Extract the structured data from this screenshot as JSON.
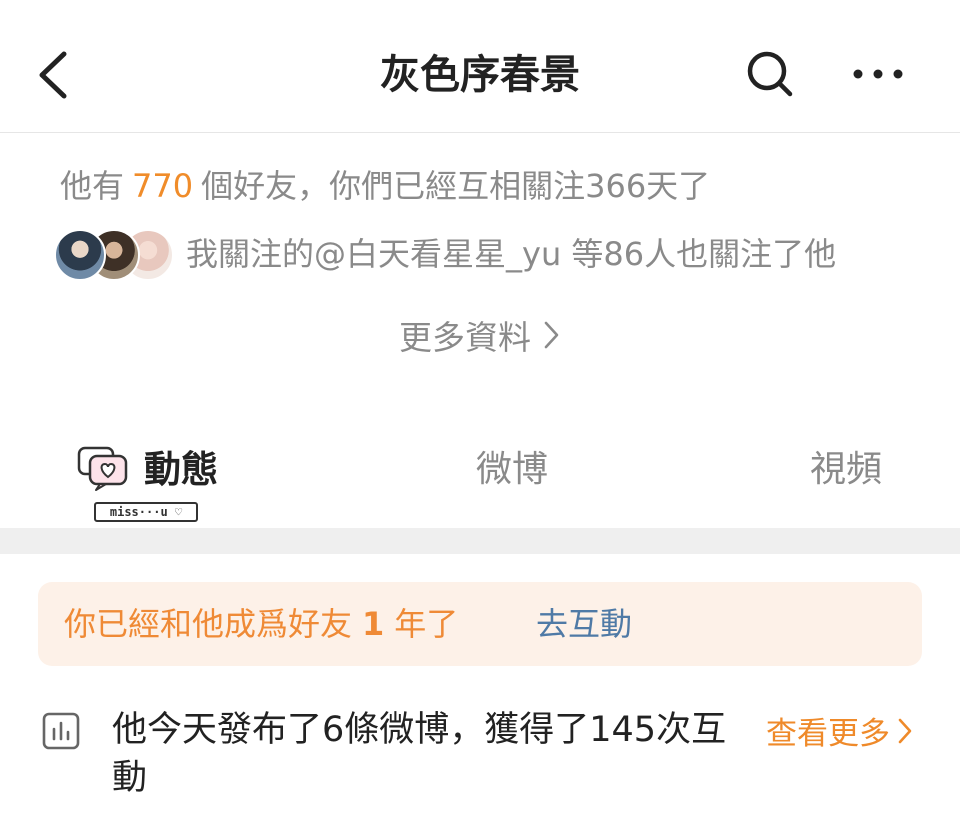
{
  "header": {
    "title": "灰色序春景",
    "back_icon": "back-arrow-icon",
    "search_icon": "search-icon",
    "more_icon": "more-dots-icon"
  },
  "friends": {
    "prefix": "他有",
    "count": "770",
    "suffix": "個好友，你們已經互相關注366天了"
  },
  "mutual": {
    "text": "我關注的@白天看星星_yu  等86人也關注了他"
  },
  "more_info": {
    "label": "更多資料"
  },
  "tabs": [
    {
      "label": "動態",
      "active": true
    },
    {
      "label": "微博",
      "active": false
    },
    {
      "label": "視頻",
      "active": false
    }
  ],
  "sticker_badge": "miss···u ♡",
  "banner": {
    "text_before": "你已經和他成爲好友",
    "years": "1",
    "text_after": "年了",
    "link": "去互動"
  },
  "stats": {
    "text": "他今天發布了6條微博，獲得了145次互動",
    "view_more": "查看更多"
  },
  "colors": {
    "accent_orange": "#ef8a2a",
    "link_blue": "#4f7aa6",
    "banner_bg": "#fdf1e8",
    "muted_text": "#8a8a8a"
  }
}
